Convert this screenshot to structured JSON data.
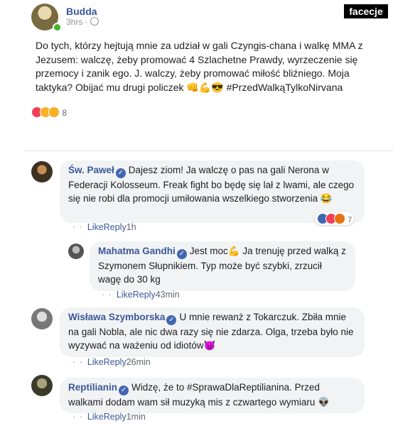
{
  "brand": "facecje",
  "post": {
    "author": "Budda",
    "time": "3hrs",
    "text": "Do tych, którzy hejtują mnie za udział w gali Czyngis-chana i walkę MMA z Jezusem: walczę, żeby promować 4 Szlachetne Prawdy, wyrzeczenie się przemocy i zanik ego. J. walczy, żeby promować miłość bliźniego. Moja taktyka? Obijać mu drugi policzek 👊💪😎 #PrzedWalkąTylkoNirvana",
    "reaction_count": "8"
  },
  "comments": [
    {
      "author": "Św. Paweł",
      "text": "Dajesz ziom! Ja walczę o pas na gali Nerona w Federacji Kolosseum. Freak fight bo będę się lał z lwami, ale czego się nie robi dla promocji umiłowania wszelkiego stworzenia 😂",
      "like": "Like",
      "reply": "Reply",
      "time": "1h",
      "reaction_count": "7"
    },
    {
      "author": "Mahatma Gandhi",
      "text": "Jest moc💪 Ja trenuję przed walką z Szymonem Słupnikiem. Typ może być szybki, zrzucił wagę do 30 kg",
      "like": "Like",
      "reply": "Reply",
      "time": "43min"
    },
    {
      "author": "Wisława Szymborska",
      "text": "U mnie rewanż z Tokarczuk. Zbiła mnie na gali Nobla, ale nic dwa razy się nie zdarza. Olga, trzeba było nie wyzywać na ważeniu od idiotów😈",
      "like": "Like",
      "reply": "Reply",
      "time": "26min"
    },
    {
      "author": "Reptilianin",
      "text": "Widzę, że to #SprawaDlaReptilianina. Przed walkami dodam wam sił muzyką mis z czwartego wymiaru 👽",
      "like": "Like",
      "reply": "Reply",
      "time": "1min"
    }
  ],
  "colors": {
    "link": "#385898",
    "bubble": "#f2f3f5",
    "online": "#42b72a"
  }
}
